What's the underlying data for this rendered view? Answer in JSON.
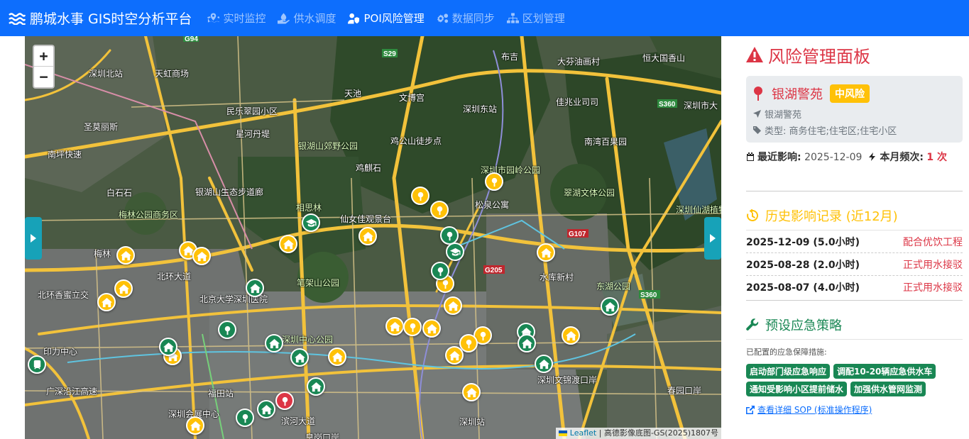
{
  "navbar": {
    "brand": "鹏城水事 GIS时空分析平台",
    "items": [
      {
        "label": "实时监控",
        "icon": "map-marked-icon",
        "active": false
      },
      {
        "label": "供水调度",
        "icon": "hand-holding-water-icon",
        "active": false
      },
      {
        "label": "POI风险管理",
        "icon": "user-shield-icon",
        "active": true
      },
      {
        "label": "数据同步",
        "icon": "cogs-icon",
        "active": false
      },
      {
        "label": "区划管理",
        "icon": "sitemap-icon",
        "active": false
      }
    ]
  },
  "map": {
    "zoom_in": "+",
    "zoom_out": "−",
    "attribution_leaflet": "Leaflet",
    "attribution_rest": " | 高德影像底图-GS(2025)1807号",
    "labels": [
      "深圳北站",
      "天虹商场",
      "天池",
      "文博宫",
      "深圳东站",
      "大芬油画村",
      "布吉",
      "恒大国香山",
      "民乐翠园小区",
      "佳兆业司司",
      "深圳市大",
      "圣莫丽斯",
      "星河丹堤",
      "银湖山郊野公园",
      "鸡公山徒步点",
      "南坪快速",
      "南湾百果园",
      "鸡麒石",
      "深圳市园岭公园",
      "白石石",
      "银湖山生态步道廊",
      "梅林公园商务区",
      "翠湖文体公园",
      "相思林",
      "仙女佳观景台",
      "松泉公寓",
      "深圳仙湖植物",
      "梅林",
      "北环大道",
      "北环香蜜立交",
      "北京大学深圳医院",
      "笔架山公园",
      "水库新村",
      "东湖公园",
      "深圳中心公园",
      "印力中心",
      "深圳文锦渡口岸",
      "福田站",
      "深圳会展中心",
      "滨河大道",
      "皇岗口岸",
      "深圳站",
      "春园口岸",
      "广深沿江高速"
    ],
    "road_badges": [
      "S29",
      "G94",
      "S360",
      "G107",
      "G205"
    ]
  },
  "panel": {
    "title": "风险管理面板",
    "poi": {
      "name": "银湖警苑",
      "risk_level": "中风险",
      "address": "银湖警苑",
      "type_label": "类型:",
      "type_value": "商务住宅;住宅区;住宅小区"
    },
    "stats": {
      "last_impact_label": "最近影响:",
      "last_impact_value": "2025-12-09",
      "monthly_freq_label": "本月频次:",
      "monthly_freq_value": "1 次"
    },
    "history": {
      "title": "历史影响记录 (近12月)",
      "rows": [
        {
          "date": "2025-12-09 (5.0小时)",
          "reason": "配合优饮工程"
        },
        {
          "date": "2025-08-28 (2.0小时)",
          "reason": "正式用水接驳"
        },
        {
          "date": "2025-08-07 (4.0小时)",
          "reason": "正式用水接驳"
        }
      ]
    },
    "plan": {
      "title": "预设应急策略",
      "note": "已配置的应急保障措施:",
      "tags": [
        "启动部门级应急响应",
        "调配10-20辆应急供水车",
        "通知受影响小区提前储水",
        "加强供水管网监测"
      ],
      "sop_link": "查看详细 SOP (标准操作程序)"
    }
  },
  "colors": {
    "primary": "#0d6efd",
    "danger": "#dc3545",
    "warning": "#ffc107",
    "success": "#198754",
    "info": "#17a2b8"
  }
}
